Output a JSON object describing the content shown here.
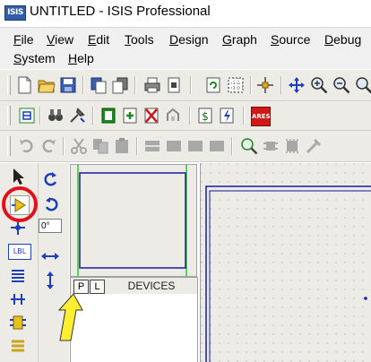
{
  "window": {
    "title": "UNTITLED - ISIS Professional",
    "logo_text": "ISIS"
  },
  "menu": [
    {
      "label": "File",
      "accel": "F",
      "rest": "ile"
    },
    {
      "label": "View",
      "accel": "V",
      "rest": "iew"
    },
    {
      "label": "Edit",
      "accel": "E",
      "rest": "dit"
    },
    {
      "label": "Tools",
      "accel": "T",
      "rest": "ools"
    },
    {
      "label": "Design",
      "accel": "D",
      "rest": "esign"
    },
    {
      "label": "Graph",
      "accel": "G",
      "rest": "raph"
    },
    {
      "label": "Source",
      "accel": "S",
      "rest": "ource"
    },
    {
      "label": "Debug",
      "accel": "D",
      "rest": "ebug"
    },
    {
      "label": "System",
      "accel": "S",
      "rest": "ystem"
    },
    {
      "label": "Help",
      "accel": "H",
      "rest": "elp"
    }
  ],
  "toolbar": {
    "ares_label": "ARES"
  },
  "rotation": {
    "value": "0°"
  },
  "devices_panel": {
    "pick_label": "P",
    "library_label": "L",
    "title": "DEVICES"
  },
  "sidebar": {
    "label_tool": "LBL"
  },
  "colors": {
    "highlight_circle": "#e0111a",
    "arrow": "#ffee33",
    "sheet_border": "#1a1a9c",
    "grid_dot": "#b4b4d2"
  }
}
